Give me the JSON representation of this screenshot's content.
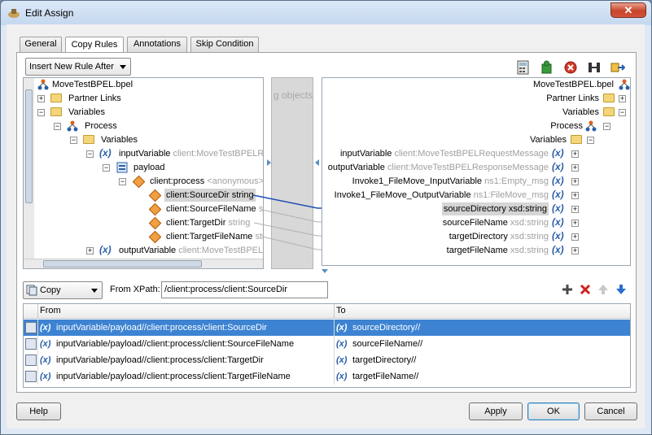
{
  "window": {
    "title": "Edit Assign",
    "close_glyph": "✕"
  },
  "tabs": [
    {
      "label": "General"
    },
    {
      "label": "Copy Rules"
    },
    {
      "label": "Annotations"
    },
    {
      "label": "Skip Condition"
    }
  ],
  "toolbar": {
    "rule_select": "Insert New Rule After",
    "icons": [
      "calculator-icon",
      "puzzle-icon",
      "delete-icon",
      "connect-icon",
      "swap-icon"
    ]
  },
  "source_tree": {
    "root": "MoveTestBPEL.bpel",
    "partner_links": "Partner Links",
    "variables": "Variables",
    "process": "Process",
    "process_variables": "Variables",
    "input_variable": "inputVariable",
    "input_variable_type": "client:MoveTestBPELRe",
    "payload": "payload",
    "client_process": "client:process",
    "client_process_type": "<anonymous>",
    "source_dir": "client:SourceDir",
    "source_dir_type": "string",
    "source_file_name": "client:SourceFileName",
    "source_file_name_type": "str",
    "target_dir": "client:TargetDir",
    "target_dir_type": "string",
    "target_file_name": "client:TargetFileName",
    "target_file_name_type": "str",
    "output_variable": "outputVariable",
    "output_variable_type": "client:MoveTestBPELR"
  },
  "middle": {
    "drag_hint": "g objects"
  },
  "target_tree": {
    "root": "MoveTestBPEL.bpel",
    "partner_links": "Partner Links",
    "variables": "Variables",
    "process": "Process",
    "process_variables": "Variables",
    "input_variable": "inputVariable",
    "input_variable_type": "client:MoveTestBPELRequestMessage",
    "output_variable": "outputVariable",
    "output_variable_type": "client:MoveTestBPELResponseMessage",
    "invoke_input": "Invoke1_FileMove_InputVariable",
    "invoke_input_type": "ns1:Empty_msg",
    "invoke_output": "Invoke1_FileMove_OutputVariable",
    "invoke_output_type": "ns1:FileMove_msg",
    "source_directory": "sourceDirectory",
    "source_directory_type": "xsd:string",
    "source_file_name": "sourceFileName",
    "source_file_name_type": "xsd:string",
    "target_directory": "targetDirectory",
    "target_directory_type": "xsd:string",
    "target_file_name": "targetFileName",
    "target_file_name_type": "xsd:string"
  },
  "copy_bar": {
    "operation": "Copy",
    "from_xpath_label": "From XPath:",
    "from_xpath_value": "/client:process/client:SourceDir"
  },
  "rules_table": {
    "columns": [
      "From",
      "To"
    ],
    "rows": [
      {
        "from": "inputVariable/payload//client:process/client:SourceDir",
        "to": "sourceDirectory//",
        "selected": true
      },
      {
        "from": "inputVariable/payload//client:process/client:SourceFileName",
        "to": "sourceFileName//",
        "selected": false
      },
      {
        "from": "inputVariable/payload//client:process/client:TargetDir",
        "to": "targetDirectory//",
        "selected": false
      },
      {
        "from": "inputVariable/payload//client:process/client:TargetFileName",
        "to": "targetFileName//",
        "selected": false
      }
    ]
  },
  "buttons": {
    "help": "Help",
    "apply": "Apply",
    "ok": "OK",
    "cancel": "Cancel"
  },
  "colors": {
    "selection": "#3d83d2",
    "mapping_line": "#1f4fb0",
    "variable_icon": "#2a5fa8"
  }
}
